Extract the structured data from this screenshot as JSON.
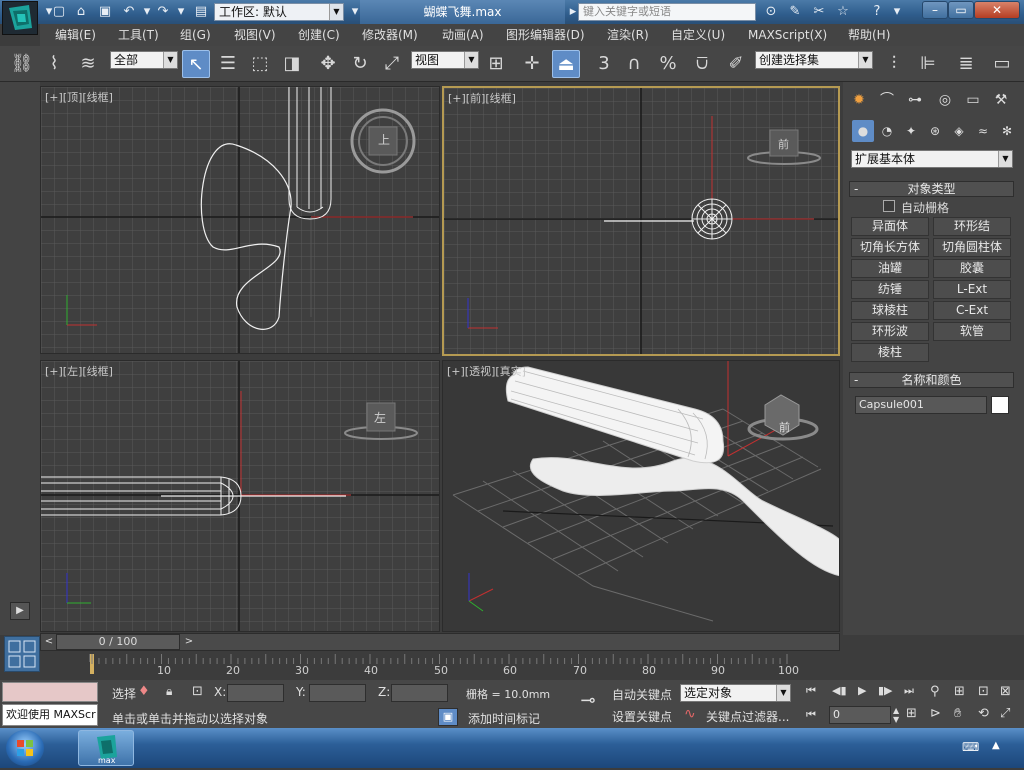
{
  "titlebar": {
    "workspace": "工作区: 默认",
    "doc_title": "蝴蝶飞舞.max",
    "search_placeholder": "键入关键字或短语"
  },
  "menu": [
    "编辑(E)",
    "工具(T)",
    "组(G)",
    "视图(V)",
    "创建(C)",
    "修改器(M)",
    "动画(A)",
    "图形编辑器(D)",
    "渲染(R)",
    "自定义(U)",
    "MAXScript(X)",
    "帮助(H)"
  ],
  "toolbar": {
    "filter": "全部",
    "ref_coord": "视图",
    "selection_set": "创建选择集",
    "snap3": "3",
    "snap_pct": "%"
  },
  "viewports": {
    "top": "[+][顶][线框]",
    "front": "[+][前][线框]",
    "left": "[+][左][线框]",
    "persp": "[+][透视][真实]",
    "cube_top": "上",
    "cube_front": "前",
    "cube_left": "左",
    "cube_persp": "前"
  },
  "command_panel": {
    "category": "扩展基本体",
    "object_type_title": "对象类型",
    "autogrid": "自动栅格",
    "buttons": [
      [
        "异面体",
        "环形结"
      ],
      [
        "切角长方体",
        "切角圆柱体"
      ],
      [
        "油罐",
        "胶囊"
      ],
      [
        "纺锤",
        "L-Ext"
      ],
      [
        "球棱柱",
        "C-Ext"
      ],
      [
        "环形波",
        "软管"
      ],
      [
        "棱柱",
        ""
      ]
    ],
    "name_color_title": "名称和颜色",
    "object_name": "Capsule001",
    "object_color": "#ffffff"
  },
  "timeline": {
    "frame": "0 / 100",
    "ticks": [
      "10",
      "20",
      "30",
      "40",
      "50",
      "60",
      "70",
      "80",
      "90",
      "100"
    ]
  },
  "status": {
    "welcome": "欢迎使用 MAXScr",
    "select_label": "选择",
    "x_label": "X:",
    "y_label": "Y:",
    "z_label": "Z:",
    "grid": "栅格 = 10.0mm",
    "auto_key": "自动关键点",
    "set_key": "设置关键点",
    "key_mode": "选定对象",
    "key_filters": "关键点过滤器...",
    "prompt": "单击或单击并拖动以选择对象",
    "add_time_tag": "添加时间标记",
    "frame_field": "0"
  },
  "taskbar": {
    "app_label": "max"
  },
  "colors": {
    "accent": "#5f8cc6",
    "active_viewport": "#b59a52",
    "grid_line": "#5a5a5a",
    "grid_main": "#1a1a1a"
  }
}
